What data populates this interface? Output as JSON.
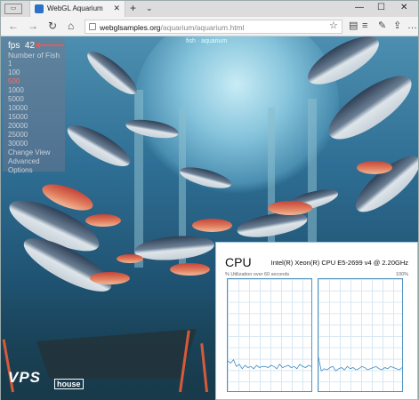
{
  "browser": {
    "tab_title": "WebGL Aquarium",
    "address_host": "webglsamples.org",
    "address_path": "/aquarium/aquarium.html",
    "new_tab_label": "+",
    "tab_dropdown_label": "⌄",
    "window_controls": [
      "—",
      "☐",
      "✕"
    ]
  },
  "aquarium": {
    "title": "fish · aquarium",
    "fps_label": "fps",
    "fps_value": "42",
    "fish_heading": "Number of Fish",
    "fish_options": [
      "1",
      "100",
      "500",
      "1000",
      "5000",
      "10000",
      "15000",
      "20000",
      "25000",
      "30000"
    ],
    "selected_option": "500",
    "menu_links": [
      "Change View",
      "Advanced",
      "Options"
    ]
  },
  "watermark": {
    "brand": "VPS",
    "suffix": "house"
  },
  "cpu_panel": {
    "title": "CPU",
    "model": "Intel(R) Xeon(R) CPU E5-2699 v4 @ 2.20GHz",
    "subtitle": "% Utilization over 60 seconds",
    "max_label": "100%",
    "core1_utilization": [
      27,
      25,
      28,
      22,
      24,
      20,
      23,
      21,
      22,
      20,
      23,
      21,
      22,
      22,
      21,
      23,
      22,
      20,
      24,
      21,
      22,
      23,
      21,
      22,
      20,
      24,
      22,
      21,
      23,
      22
    ],
    "core2_utilization": [
      30,
      18,
      20,
      19,
      21,
      22,
      18,
      20,
      21,
      19,
      22,
      20,
      21,
      19,
      20,
      22,
      21,
      19,
      20,
      21,
      22,
      20,
      19,
      21,
      20,
      22,
      21,
      20,
      19,
      21
    ]
  }
}
